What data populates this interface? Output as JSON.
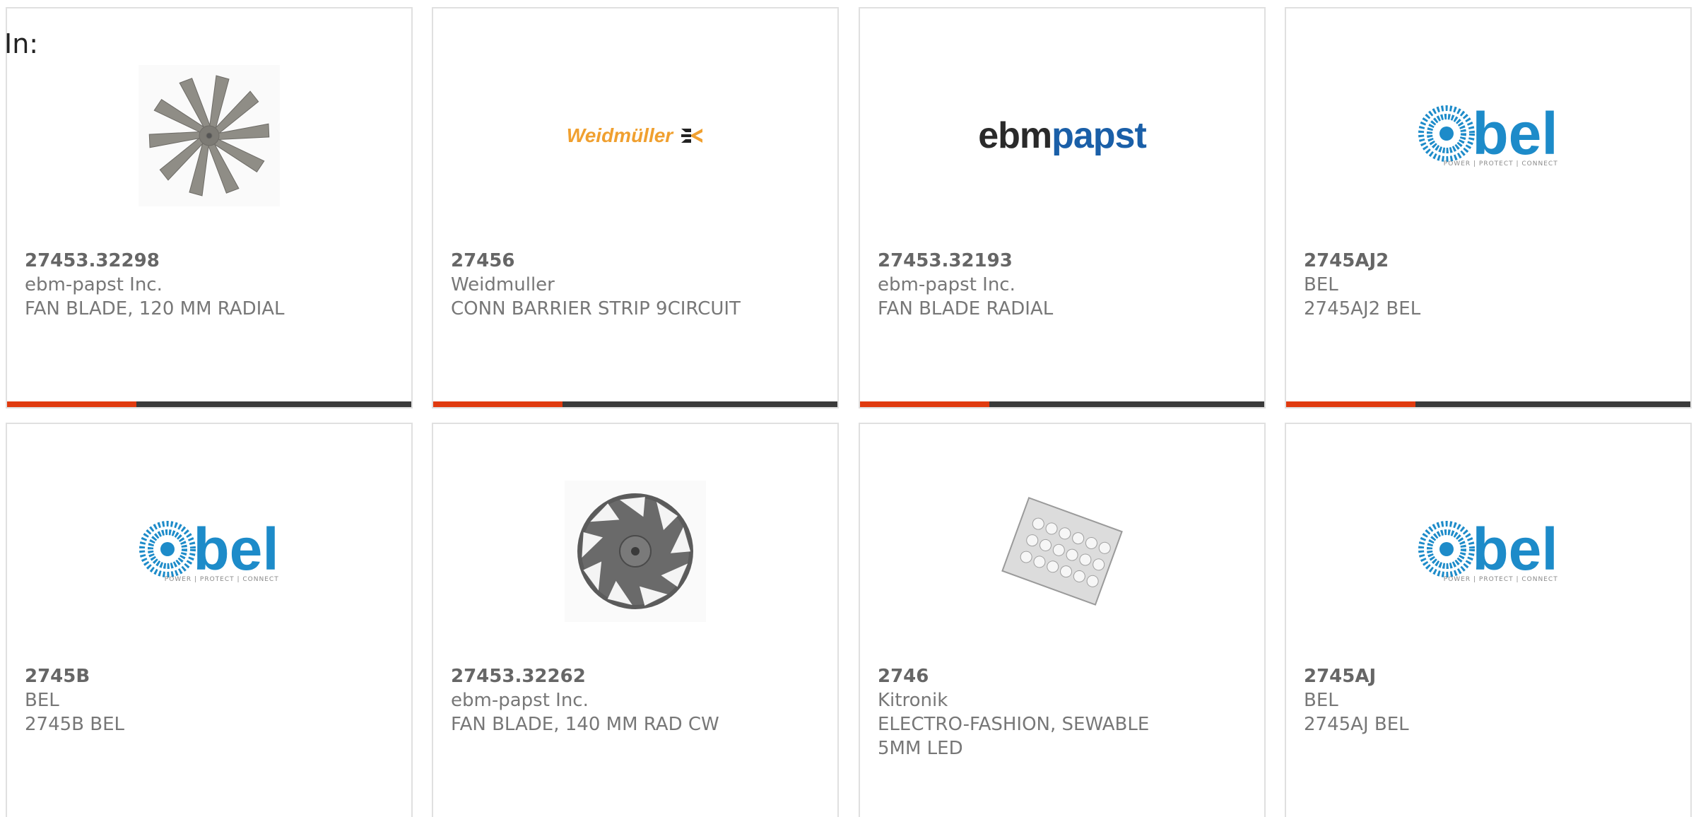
{
  "page": {
    "in_label": "In:"
  },
  "brand_colors": {
    "accent": "#e03a0f",
    "track": "#3a3a3a",
    "weidmuller_orange": "#f0a030",
    "ebm_dark": "#2a2a2a",
    "ebm_blue": "#1a5fa8",
    "bel_blue": "#1d8bc9"
  },
  "products": [
    {
      "part_number": "27453.32298",
      "manufacturer": "ebm-papst Inc.",
      "description": "FAN BLADE, 120 MM RADIAL",
      "image": "fan-blade-photo",
      "progress_fraction": 0.32
    },
    {
      "part_number": "27456",
      "manufacturer": "Weidmuller",
      "description": "CONN BARRIER STRIP 9CIRCUIT",
      "image": "weidmuller-logo",
      "logo_text": "Weidmüller",
      "progress_fraction": 0.32
    },
    {
      "part_number": "27453.32193",
      "manufacturer": "ebm-papst Inc.",
      "description": "FAN BLADE RADIAL",
      "image": "ebmpapst-logo",
      "logo_text_a": "ebm",
      "logo_text_b": "papst",
      "progress_fraction": 0.32
    },
    {
      "part_number": "2745AJ2",
      "manufacturer": "BEL",
      "description": "2745AJ2 BEL",
      "image": "bel-logo",
      "logo_text": "bel",
      "logo_tagline": "POWER | PROTECT | CONNECT",
      "progress_fraction": 0.32
    },
    {
      "part_number": "2745B",
      "manufacturer": "BEL",
      "description": "2745B BEL",
      "image": "bel-logo",
      "logo_text": "bel",
      "logo_tagline": "POWER | PROTECT | CONNECT"
    },
    {
      "part_number": "27453.32262",
      "manufacturer": "ebm-papst Inc.",
      "description": "FAN BLADE, 140 MM RAD CW",
      "image": "fan-wheel-photo"
    },
    {
      "part_number": "2746",
      "manufacturer": "Kitronik",
      "description_line1": "ELECTRO-FASHION, SEWABLE",
      "description_line2": "5MM LED",
      "image": "led-board-photo"
    },
    {
      "part_number": "2745AJ",
      "manufacturer": "BEL",
      "description": "2745AJ BEL",
      "image": "bel-logo",
      "logo_text": "bel",
      "logo_tagline": "POWER | PROTECT | CONNECT"
    }
  ]
}
